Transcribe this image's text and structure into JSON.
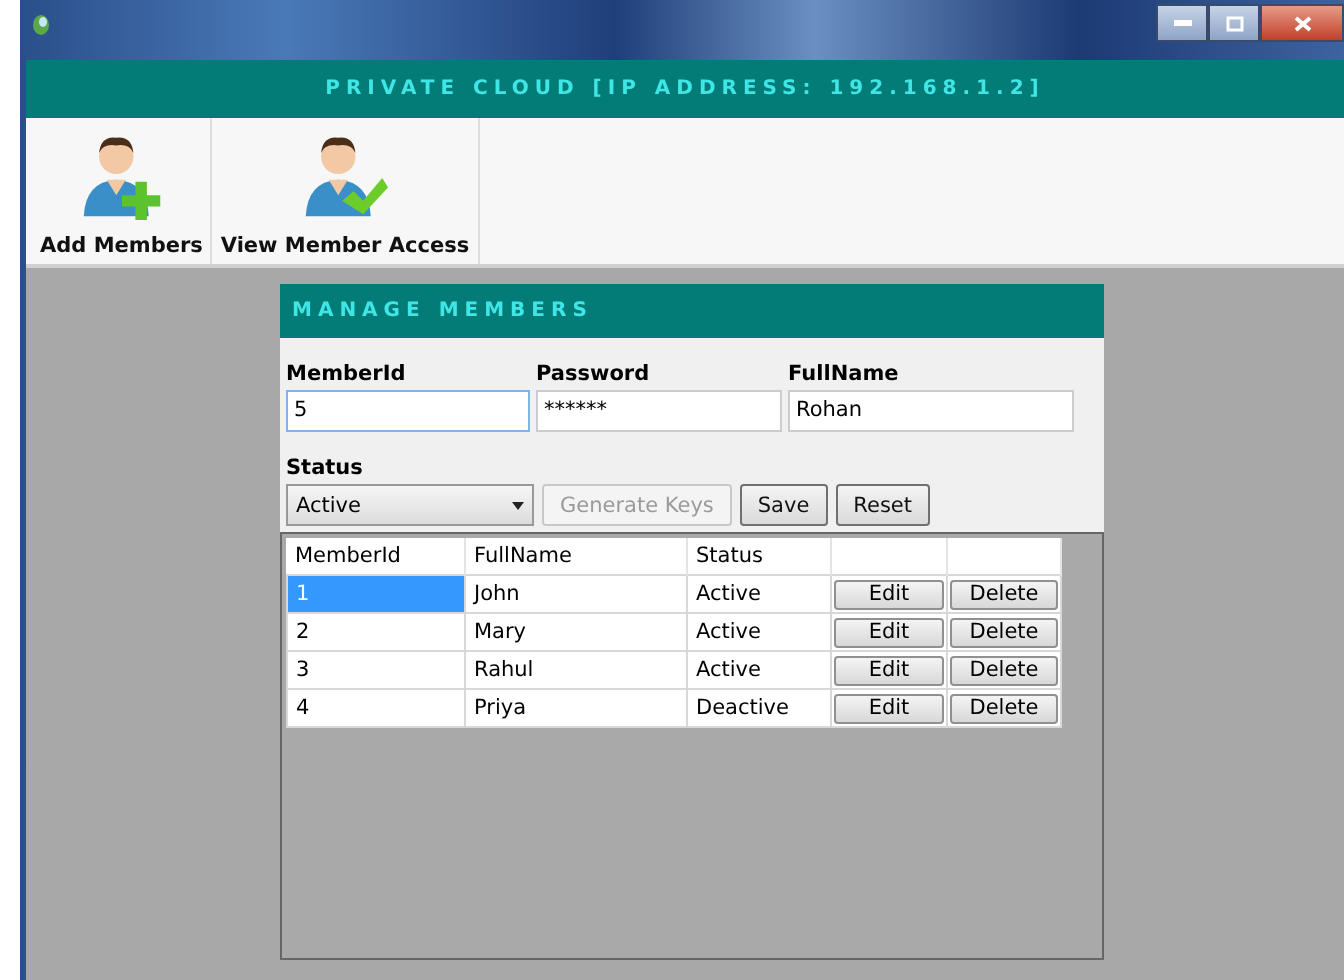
{
  "header": {
    "title": "PRIVATE CLOUD [IP ADDRESS: 192.168.1.2]"
  },
  "toolbar": [
    {
      "label": "Add Members",
      "kind": "add"
    },
    {
      "label": "View Member Access",
      "kind": "check"
    }
  ],
  "panel": {
    "title": "MANAGE MEMBERS",
    "fields": [
      {
        "label": "MemberId",
        "value": "5",
        "focused": true
      },
      {
        "label": "Password",
        "value": "******",
        "focused": false
      },
      {
        "label": "FullName",
        "value": "Rohan",
        "focused": false
      }
    ],
    "status": {
      "label": "Status",
      "value": "Active"
    },
    "buttons": [
      {
        "label": "Generate Keys",
        "disabled": true
      },
      {
        "label": "Save",
        "disabled": false
      },
      {
        "label": "Reset",
        "disabled": false
      }
    ]
  },
  "table": {
    "columns": [
      "MemberId",
      "FullName",
      "Status"
    ],
    "rows": [
      {
        "cells": [
          "1",
          "John",
          "Active"
        ],
        "selected": true,
        "actions": [
          "Edit",
          "Delete"
        ]
      },
      {
        "cells": [
          "2",
          "Mary",
          "Active"
        ],
        "selected": false,
        "actions": [
          "Edit",
          "Delete"
        ]
      },
      {
        "cells": [
          "3",
          "Rahul",
          "Active"
        ],
        "selected": false,
        "actions": [
          "Edit",
          "Delete"
        ]
      },
      {
        "cells": [
          "4",
          "Priya",
          "Deactive"
        ],
        "selected": false,
        "actions": [
          "Edit",
          "Delete"
        ]
      }
    ]
  }
}
